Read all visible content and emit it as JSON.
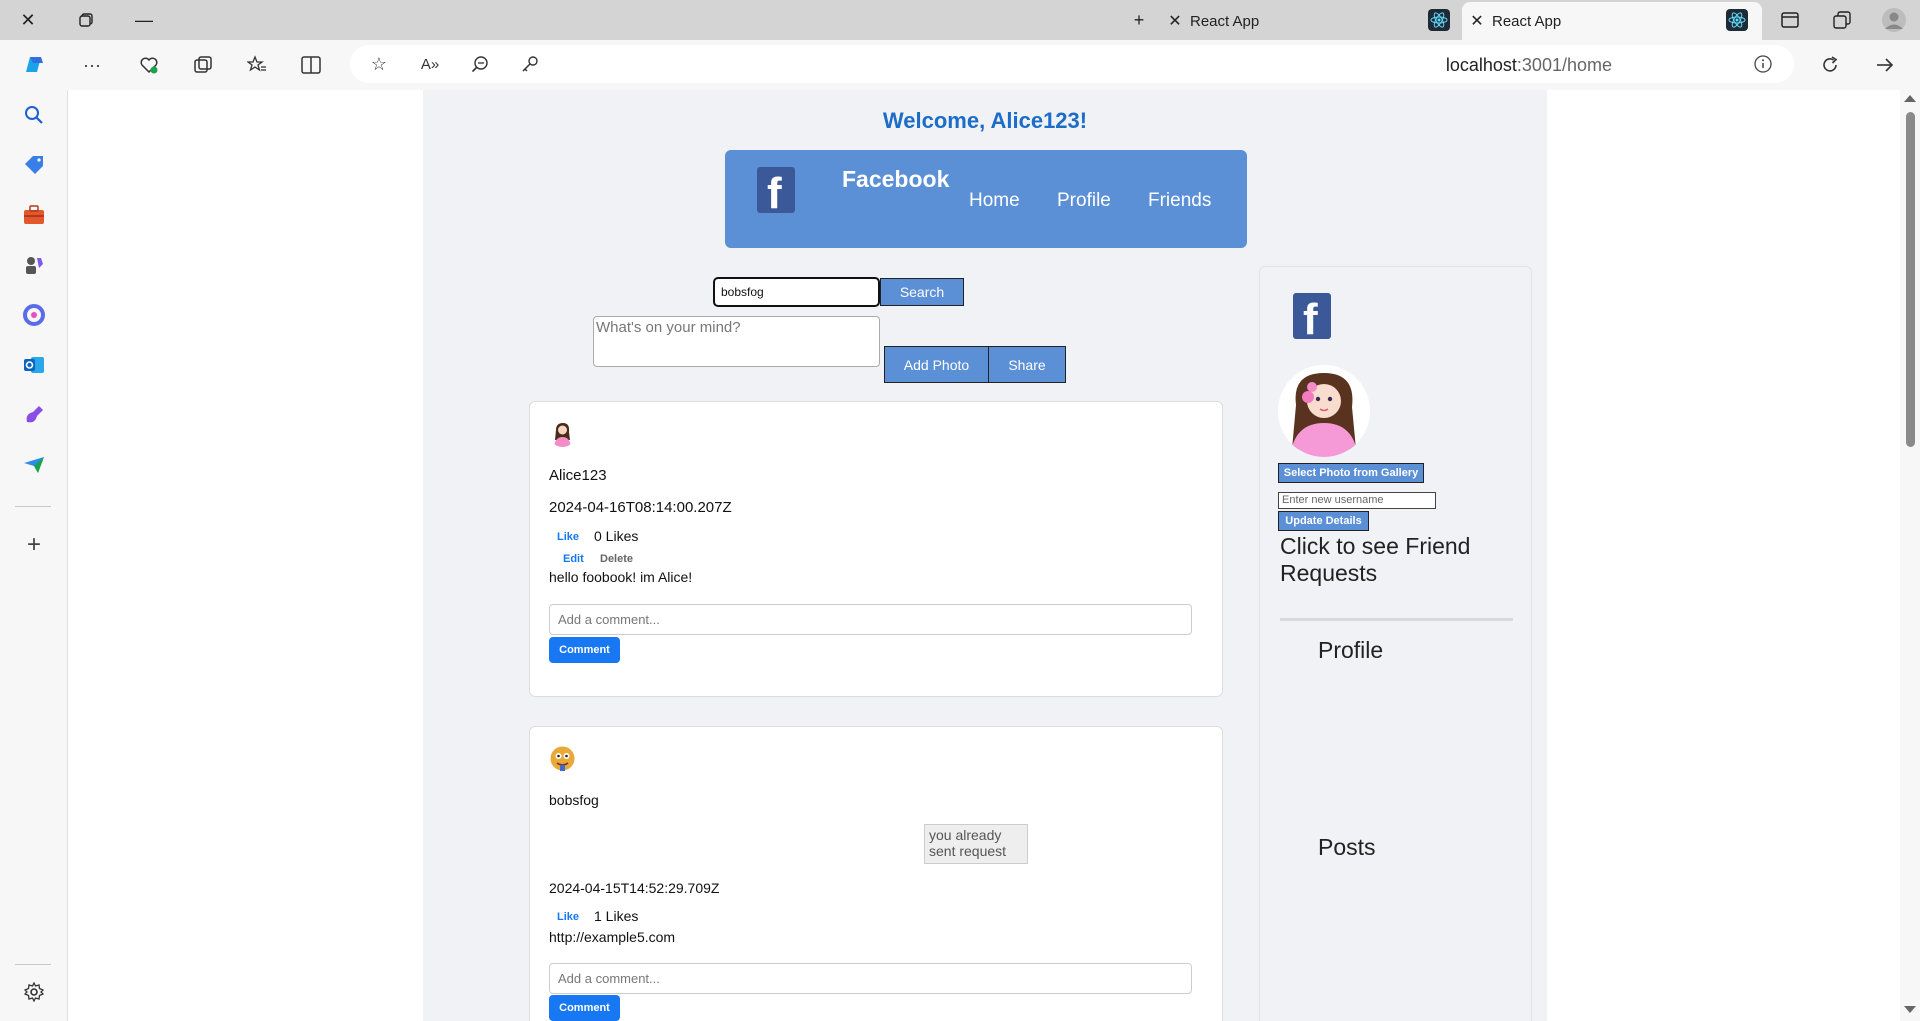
{
  "browser": {
    "tabs": [
      {
        "title": "React App",
        "active": false
      },
      {
        "title": "React App",
        "active": true
      }
    ],
    "url_host": "localhost",
    "url_rest": ":3001/home"
  },
  "app": {
    "welcome": "Welcome, Alice123!",
    "header": {
      "brand": "Facebook",
      "nav": [
        "Home",
        "Profile",
        "Friends"
      ]
    },
    "search": {
      "value": "bobsfog",
      "button": "Search"
    },
    "composer": {
      "placeholder": "What's on your mind?",
      "add_photo": "Add Photo",
      "share": "Share"
    },
    "posts": [
      {
        "username": "Alice123",
        "timestamp": "2024-04-16T08:14:00.207Z",
        "like_label": "Like",
        "likes": "0 Likes",
        "edit_label": "Edit",
        "delete_label": "Delete",
        "content": "hello foobook! im Alice!",
        "comment_placeholder": "Add a comment...",
        "comment_button": "Comment"
      },
      {
        "username": "bobsfog",
        "request_status": "you already sent request",
        "timestamp": "2024-04-15T14:52:29.709Z",
        "like_label": "Like",
        "likes": "1 Likes",
        "content": "http://example5.com",
        "comment_placeholder": "Add a comment...",
        "comment_button": "Comment"
      }
    ],
    "sidebar": {
      "select_photo": "Select Photo from Gallery",
      "username_placeholder": "Enter new username",
      "update_button": "Update Details",
      "friend_requests": "Click to see Friend Requests",
      "profile_heading": "Profile",
      "posts_heading": "Posts"
    }
  },
  "colors": {
    "accent": "#5b8fd6",
    "welcome": "#1c6dc8",
    "comment_button": "#1877f2",
    "facebook": "#3b5998"
  }
}
